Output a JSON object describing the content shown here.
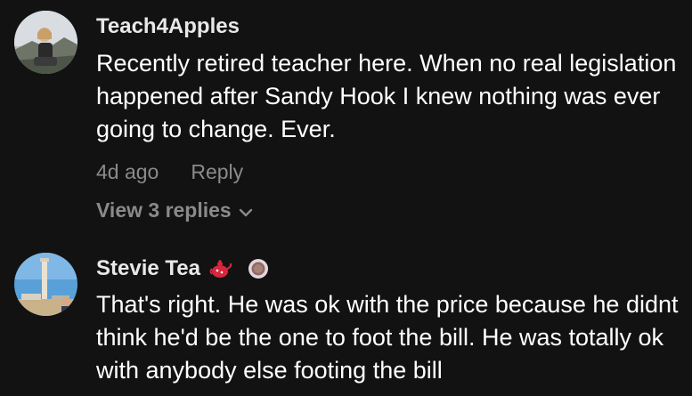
{
  "comments": [
    {
      "username": "Teach4Apples",
      "text": "Recently retired teacher here. When no real legislation happened after Sandy Hook I knew nothing was ever going to change. Ever.",
      "time": "4d ago",
      "reply_label": "Reply",
      "view_replies_label": "View 3 replies"
    },
    {
      "username": "Stevie Tea",
      "text": "That's right. He was ok with the price because he didnt think he'd be the one to foot the bill. He was totally ok with anybody else footing the bill"
    }
  ],
  "icons": {
    "chevron": "chevron-down-icon",
    "teapot": "teapot-icon",
    "tea_cup": "tea-cup-icon"
  },
  "colors": {
    "background": "#121212",
    "text": "#ffffff",
    "muted": "#8a8a8a"
  }
}
